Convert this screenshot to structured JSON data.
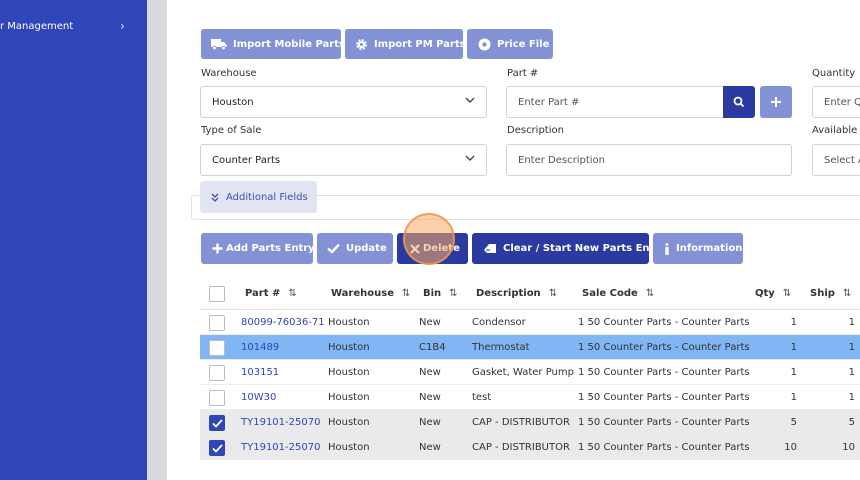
{
  "sidebar": {
    "item_label": "r Management"
  },
  "top_buttons": {
    "import_mobile": "Import Mobile Parts",
    "import_pm": "Import PM Parts",
    "price_file": "Price File"
  },
  "form": {
    "warehouse": {
      "label": "Warehouse",
      "value": "Houston"
    },
    "part": {
      "label": "Part #",
      "placeholder": "Enter Part #"
    },
    "quantity": {
      "label": "Quantity",
      "placeholder": "Enter Q"
    },
    "type_of_sale": {
      "label": "Type of Sale",
      "value": "Counter Parts"
    },
    "description": {
      "label": "Description",
      "placeholder": "Enter Description"
    },
    "available": {
      "label": "Available S",
      "placeholder": "Select A"
    }
  },
  "additional_fields": "Additional Fields",
  "actions": {
    "add": "Add Parts Entry",
    "update": "Update",
    "delete": "Delete",
    "clear": "Clear / Start New Parts Entry",
    "information": "Information"
  },
  "table": {
    "headers": {
      "part": "Part #",
      "warehouse": "Warehouse",
      "bin": "Bin",
      "description": "Description",
      "sale_code": "Sale Code",
      "qty": "Qty",
      "ship": "Ship"
    },
    "sort_glyph": "⇅",
    "rows": [
      {
        "checked": false,
        "selected": false,
        "part": "80099-76036-71",
        "warehouse": "Houston",
        "bin": "New",
        "description": "Condensor",
        "sale_code": "1 50 Counter Parts - Counter Parts",
        "qty": "1",
        "ship": "1"
      },
      {
        "checked": false,
        "selected": true,
        "part": "101489",
        "warehouse": "Houston",
        "bin": "C1B4",
        "description": "Thermostat",
        "sale_code": "1 50 Counter Parts - Counter Parts",
        "qty": "1",
        "ship": "1"
      },
      {
        "checked": false,
        "selected": false,
        "part": "103151",
        "warehouse": "Houston",
        "bin": "New",
        "description": "Gasket, Water Pump",
        "sale_code": "1 50 Counter Parts - Counter Parts",
        "qty": "1",
        "ship": "1"
      },
      {
        "checked": false,
        "selected": false,
        "part": "10W30",
        "warehouse": "Houston",
        "bin": "New",
        "description": "test",
        "sale_code": "1 50 Counter Parts - Counter Parts",
        "qty": "1",
        "ship": "1"
      },
      {
        "checked": true,
        "selected": false,
        "part": "TY19101-25070",
        "warehouse": "Houston",
        "bin": "New",
        "description": "CAP - DISTRIBUTOR",
        "sale_code": "1 50 Counter Parts - Counter Parts",
        "qty": "5",
        "ship": "5"
      },
      {
        "checked": true,
        "selected": false,
        "part": "TY19101-25070",
        "warehouse": "Houston",
        "bin": "New",
        "description": "CAP - DISTRIBUTOR",
        "sale_code": "1 50 Counter Parts - Counter Parts",
        "qty": "10",
        "ship": "10"
      }
    ]
  },
  "colors": {
    "sidebar": "#2f46b8",
    "button_light": "#8392d4",
    "button_dark": "#2a3aa0",
    "row_selected": "#7fb6f3",
    "row_checked": "#eaeaec",
    "link": "#2f46b8"
  }
}
